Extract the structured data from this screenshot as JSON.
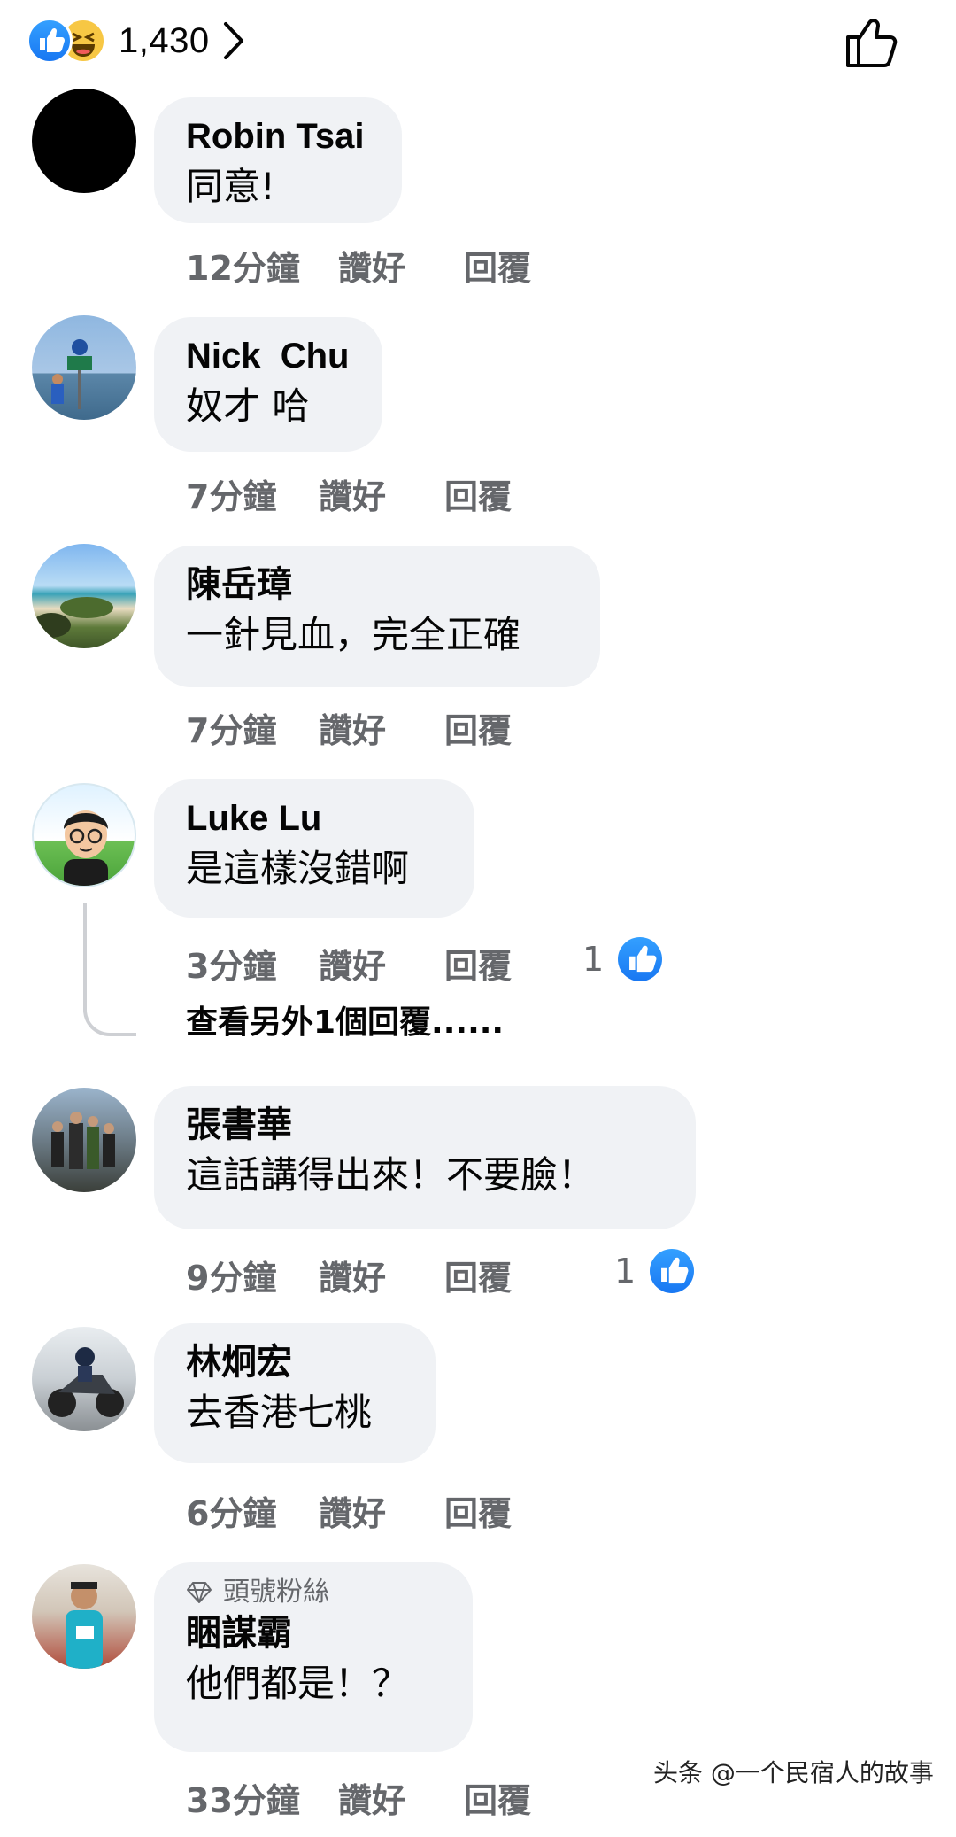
{
  "reactions": {
    "count": "1,430",
    "types": [
      "like",
      "haha"
    ]
  },
  "colors": {
    "facebook_blue": "#1877f2",
    "bubble_bg": "#f0f2f5",
    "meta_gray": "#65676b"
  },
  "actions": {
    "like_label": "讚好",
    "reply_label": "回覆"
  },
  "comments": [
    {
      "author": "Robin Tsai",
      "text": "同意!",
      "time": "12分鐘"
    },
    {
      "author": "Nick  Chu",
      "text": "奴才 哈",
      "time": "7分鐘"
    },
    {
      "author": "陳岳璋",
      "text": "一針見血，完全正確",
      "time": "7分鐘"
    },
    {
      "author": "Luke Lu",
      "text": "是這樣沒錯啊",
      "time": "3分鐘",
      "likes": "1"
    },
    {
      "author": "張書華",
      "text": "這話講得出來！不要臉！",
      "time": "9分鐘",
      "likes": "1"
    },
    {
      "author": "林炯宏",
      "text": "去香港七桃",
      "time": "6分鐘"
    },
    {
      "badge": "頭號粉絲",
      "author": "睏謀霸",
      "text": "他們都是！？",
      "time": "33分鐘"
    }
  ],
  "view_more_replies": "查看另外1個回覆......",
  "watermark": "头条 @一个民宿人的故事"
}
